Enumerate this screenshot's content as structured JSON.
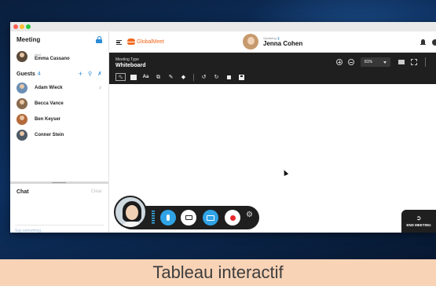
{
  "sidebar": {
    "title": "Meeting",
    "host": {
      "role": "Host",
      "name": "Emma Cassano"
    },
    "guests_label": "Guests",
    "guests_count": "4",
    "guests": [
      {
        "name": "Adam Wieck"
      },
      {
        "name": "Becca Vance"
      },
      {
        "name": "Ben Keyser"
      },
      {
        "name": "Conner Stein"
      }
    ],
    "chat_title": "Chat",
    "chat_clear": "Clear",
    "chat_placeholder": "Say something..."
  },
  "header": {
    "logo_text": "GlobalMeet",
    "speaking_label": "Speaking",
    "speaker_name": "Jenna Cohen"
  },
  "whiteboard": {
    "meeting_type_label": "Meeting Type",
    "meeting_type_value": "Whiteboard",
    "zoom_value": "81%"
  },
  "controls": {
    "end_meeting_label": "END MEETING"
  },
  "caption": "Tableau interactif",
  "colors": {
    "accent_blue": "#2fa3e6",
    "brand_orange": "#f26a21",
    "toolbar_dark": "#1f1f1f",
    "caption_band": "#f9d3b6",
    "record_red": "#e8262b"
  },
  "icons": [
    "lock-icon",
    "menu-icon",
    "bell-icon",
    "globe-icon",
    "zoom-in-icon",
    "zoom-out-icon",
    "select-tool-icon",
    "image-tool-icon",
    "text-tool-icon",
    "shapes-tool-icon",
    "pen-tool-icon",
    "eraser-tool-icon",
    "undo-icon",
    "redo-icon",
    "trash-icon",
    "save-icon",
    "mic-icon",
    "camera-icon",
    "screen-share-icon",
    "record-icon",
    "gear-icon",
    "exit-icon"
  ]
}
